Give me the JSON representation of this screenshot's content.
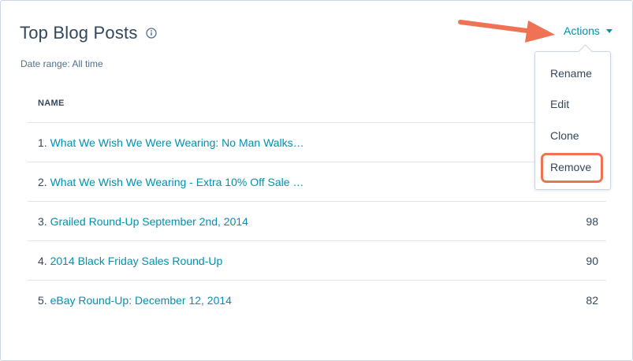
{
  "widget": {
    "title": "Top Blog Posts",
    "date_range": "Date range: All time",
    "actions_label": "Actions"
  },
  "table": {
    "header": "NAME",
    "rows": [
      {
        "num": "1.",
        "title": "What We Wish We Were Wearing: No Man Walks…",
        "value": ""
      },
      {
        "num": "2.",
        "title": "What We Wish We Wearing - Extra 10% Off Sale …",
        "value": ""
      },
      {
        "num": "3.",
        "title": "Grailed Round-Up September 2nd, 2014",
        "value": "98"
      },
      {
        "num": "4.",
        "title": "2014 Black Friday Sales Round-Up",
        "value": "90"
      },
      {
        "num": "5.",
        "title": "eBay Round-Up: December 12, 2014",
        "value": "82"
      }
    ]
  },
  "menu": {
    "items": [
      "Rename",
      "Edit",
      "Clone",
      "Remove"
    ]
  },
  "colors": {
    "link": "#0091ae",
    "text": "#33475b",
    "annotation": "#f07254"
  }
}
